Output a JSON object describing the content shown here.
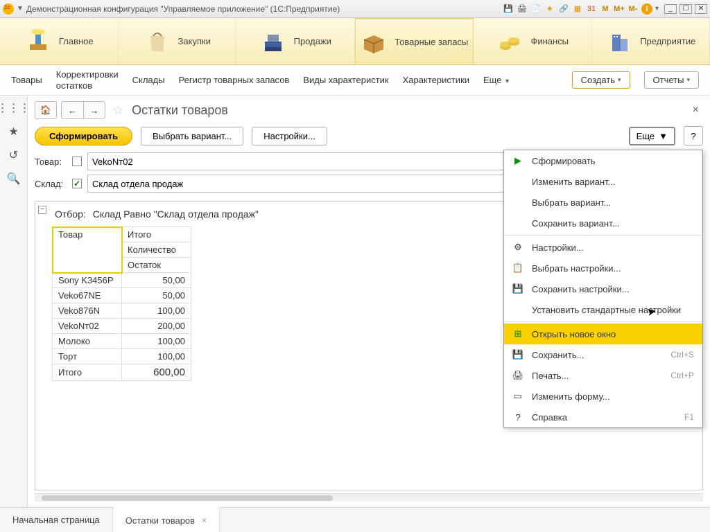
{
  "window": {
    "title": "Демонстрационная конфигурация \"Управляемое приложение\"  (1С:Предприятие)"
  },
  "titlebar_buttons": {
    "m1": "M",
    "m2": "M+",
    "m3": "M-"
  },
  "mainnav": [
    {
      "label": "Главное"
    },
    {
      "label": "Закупки"
    },
    {
      "label": "Продажи"
    },
    {
      "label": "Товарные запасы"
    },
    {
      "label": "Финансы"
    },
    {
      "label": "Предприятие"
    }
  ],
  "subnav": {
    "items": [
      "Товары",
      "Корректировки\nостатков",
      "Склады",
      "Регистр товарных запасов",
      "Виды характеристик",
      "Характеристики"
    ],
    "more": "Еще",
    "create": "Создать",
    "reports": "Отчеты"
  },
  "page": {
    "title": "Остатки товаров"
  },
  "toolbar": {
    "run": "Сформировать",
    "variant": "Выбрать вариант...",
    "settings": "Настройки...",
    "more": "Еще",
    "help": "?"
  },
  "filters": {
    "product_label": "Товар:",
    "product_value": "VekoNт02",
    "warehouse_label": "Склад:",
    "warehouse_value": "Склад отдела продаж"
  },
  "report": {
    "filter_label": "Отбор:",
    "filter_value": "Склад Равно \"Склад отдела продаж\"",
    "col_product": "Товар",
    "col_total": "Итого",
    "col_qty": "Количество",
    "col_rest": "Остаток",
    "rows": [
      {
        "name": "Sony K3456P",
        "val": "50,00"
      },
      {
        "name": "Veko67NE",
        "val": "50,00"
      },
      {
        "name": "Veko876N",
        "val": "100,00"
      },
      {
        "name": "VekoNт02",
        "val": "200,00"
      },
      {
        "name": "Молоко",
        "val": "100,00"
      },
      {
        "name": "Торт",
        "val": "100,00"
      }
    ],
    "total_label": "Итого",
    "total_val": "600,00"
  },
  "dropdown": [
    {
      "icon": "play",
      "label": "Сформировать"
    },
    {
      "label": "Изменить вариант..."
    },
    {
      "label": "Выбрать вариант..."
    },
    {
      "label": "Сохранить вариант..."
    },
    {
      "sep": true
    },
    {
      "icon": "gear",
      "label": "Настройки..."
    },
    {
      "icon": "pick",
      "label": "Выбрать настройки..."
    },
    {
      "icon": "save-set",
      "label": "Сохранить настройки..."
    },
    {
      "label": "Установить стандартные настройки"
    },
    {
      "sep": true
    },
    {
      "icon": "new-win",
      "label": "Открыть новое окно",
      "hl": true
    },
    {
      "icon": "disk",
      "label": "Сохранить...",
      "shortcut": "Ctrl+S"
    },
    {
      "icon": "print",
      "label": "Печать...",
      "shortcut": "Ctrl+P"
    },
    {
      "icon": "form",
      "label": "Изменить форму..."
    },
    {
      "icon": "help",
      "label": "Справка",
      "shortcut": "F1"
    }
  ],
  "tabs": {
    "home": "Начальная страница",
    "current": "Остатки товаров"
  }
}
